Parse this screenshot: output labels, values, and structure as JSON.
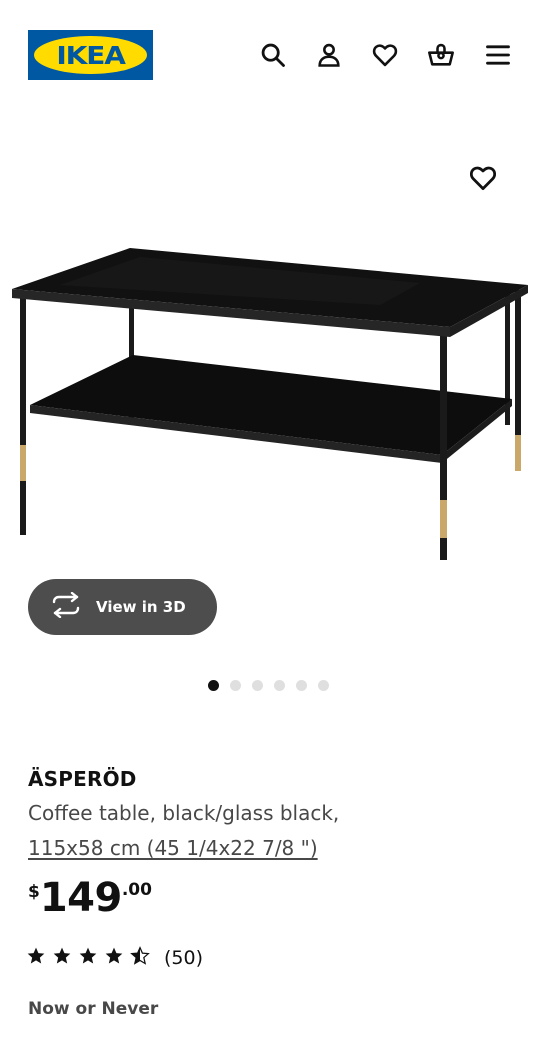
{
  "header": {
    "logo_text": "IKEA",
    "icons": [
      "search-icon",
      "account-icon",
      "favourites-icon",
      "basket-icon",
      "menu-icon"
    ]
  },
  "gallery": {
    "view3d_label": "View in 3D",
    "image_count": 6,
    "active_image": 1
  },
  "product": {
    "name": "ÄSPERÖD",
    "description": "Coffee table, black/glass black,",
    "size": "115x58 cm (45 1/4x22 7/8 \")",
    "price": {
      "currency": "$",
      "integer": "149",
      "decimals": ".00"
    },
    "rating": {
      "stars": 4.5,
      "max": 5,
      "count": "(50)"
    },
    "badge": "Now or Never"
  },
  "colors": {
    "ikea_blue": "#0058a3",
    "ikea_yellow": "#ffdb00",
    "button_dark": "#4d4d4d",
    "text_secondary": "#484848"
  }
}
